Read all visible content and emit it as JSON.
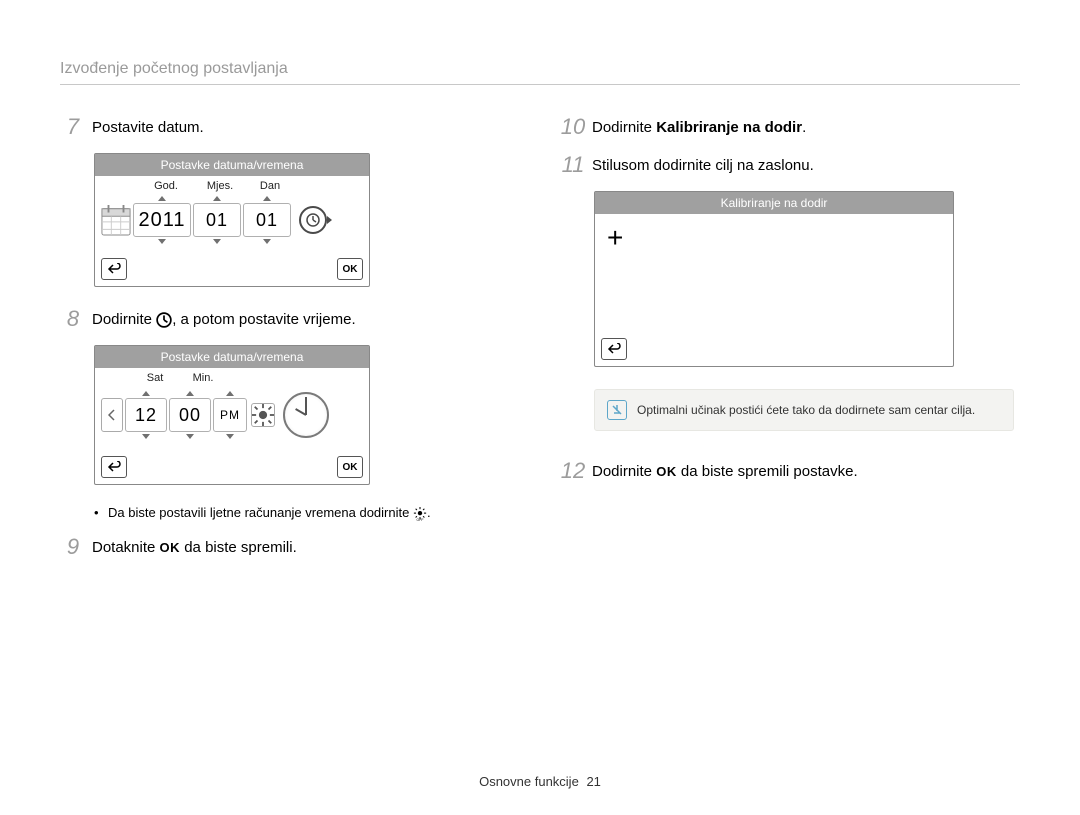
{
  "header": {
    "title": "Izvođenje početnog postavljanja"
  },
  "left": {
    "step7": {
      "num": "7",
      "text": "Postavite datum."
    },
    "date_screen": {
      "title": "Postavke datuma/vremena",
      "labels": {
        "year": "God.",
        "month": "Mjes.",
        "day": "Dan"
      },
      "values": {
        "year": "2011",
        "month": "01",
        "day": "01"
      },
      "ok": "OK"
    },
    "step8": {
      "num": "8",
      "prefix": "Dodirnite ",
      "suffix": ", a potom postavite vrijeme."
    },
    "time_screen": {
      "title": "Postavke datuma/vremena",
      "labels": {
        "hour": "Sat",
        "min": "Min."
      },
      "values": {
        "hour": "12",
        "min": "00",
        "ampm": "PM"
      },
      "ok": "OK"
    },
    "bullet": {
      "text_before": "Da biste postavili ljetne računanje vremena dodirnite ",
      "text_after": "."
    },
    "step9": {
      "num": "9",
      "prefix": "Dotaknite ",
      "ok": "OK",
      "suffix": " da biste spremili."
    }
  },
  "right": {
    "step10": {
      "num": "10",
      "prefix": "Dodirnite ",
      "bold": "Kalibriranje na dodir",
      "suffix": "."
    },
    "step11": {
      "num": "11",
      "text": "Stilusom dodirnite cilj na zaslonu."
    },
    "calib_screen": {
      "title": "Kalibriranje na dodir"
    },
    "note": "Optimalni učinak postići ćete tako da dodirnete sam centar cilja.",
    "step12": {
      "num": "12",
      "prefix": "Dodirnite ",
      "ok": "OK",
      "suffix": " da biste spremili postavke."
    }
  },
  "footer": {
    "section": "Osnovne funkcije",
    "page": "21"
  }
}
